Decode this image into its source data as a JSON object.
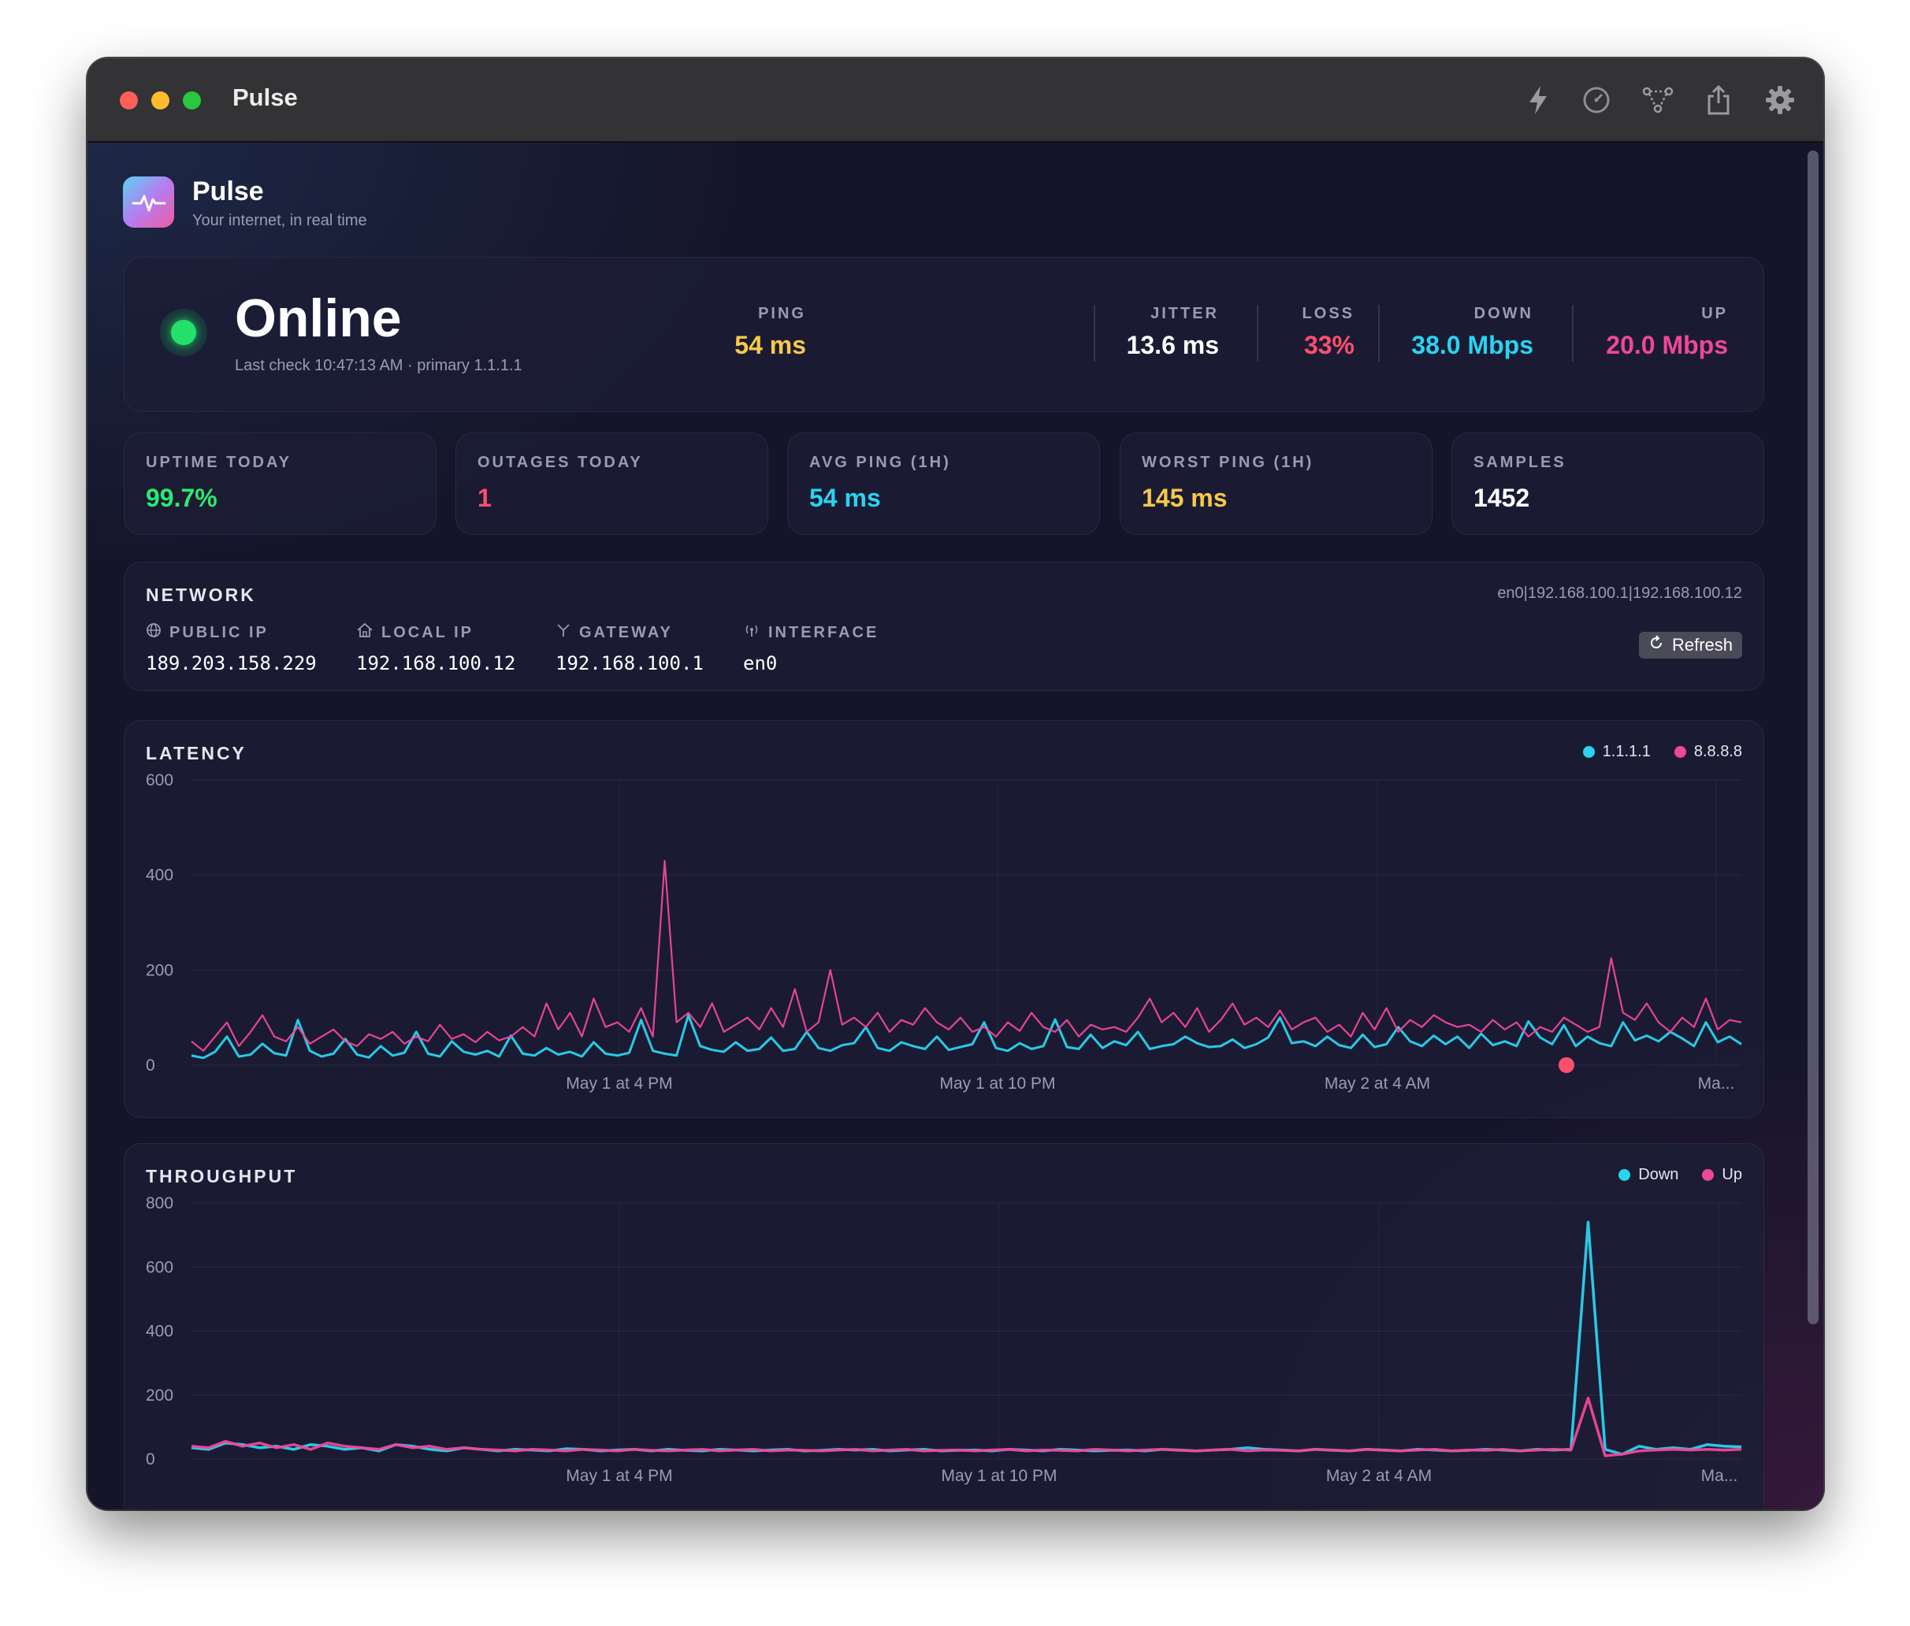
{
  "window": {
    "title": "Pulse"
  },
  "toolbar_icons": [
    "bolt-icon",
    "speedometer-icon",
    "network-icon",
    "share-icon",
    "gear-icon"
  ],
  "app": {
    "name": "Pulse",
    "subtitle": "Your internet, in real time"
  },
  "status": {
    "state": "Online",
    "detail": "Last check 10:47:13 AM · primary 1.1.1.1",
    "metrics": [
      {
        "label": "PING",
        "value": "54 ms",
        "color": "#f7c948"
      },
      {
        "label": "JITTER",
        "value": "13.6 ms",
        "color": "#ffffff"
      },
      {
        "label": "LOSS",
        "value": "33%",
        "color": "#ff4f6d"
      },
      {
        "label": "DOWN",
        "value": "38.0 Mbps",
        "color": "#2ad3f0"
      },
      {
        "label": "UP",
        "value": "20.0 Mbps",
        "color": "#f0479a"
      }
    ]
  },
  "stats": [
    {
      "label": "UPTIME TODAY",
      "value": "99.7%",
      "color": "#2ee86f"
    },
    {
      "label": "OUTAGES TODAY",
      "value": "1",
      "color": "#ff4f6d"
    },
    {
      "label": "AVG PING (1H)",
      "value": "54 ms",
      "color": "#2ad3f0"
    },
    {
      "label": "WORST PING (1H)",
      "value": "145 ms",
      "color": "#f7c948"
    },
    {
      "label": "SAMPLES",
      "value": "1452",
      "color": "#ffffff"
    }
  ],
  "network": {
    "title": "NETWORK",
    "summary": "en0|192.168.100.1|192.168.100.12",
    "public_ip_label": "PUBLIC IP",
    "public_ip": "189.203.158.229",
    "local_ip_label": "LOCAL IP",
    "local_ip": "192.168.100.12",
    "gateway_label": "GATEWAY",
    "gateway": "192.168.100.1",
    "interface_label": "INTERFACE",
    "interface": "en0",
    "refresh_label": "Refresh"
  },
  "chart_data": [
    {
      "type": "line",
      "title": "LATENCY",
      "ylim": [
        0,
        600
      ],
      "yticks": [
        "600",
        "400",
        "200",
        "0"
      ],
      "xticks": [
        "May 1 at 4 PM",
        "May 1 at 10 PM",
        "May 2 at 4 AM",
        "Ma..."
      ],
      "series": [
        {
          "name": "1.1.1.1",
          "color": "#2ad3f0",
          "values": [
            20,
            15,
            28,
            60,
            18,
            22,
            45,
            25,
            20,
            95,
            30,
            18,
            24,
            55,
            22,
            16,
            40,
            20,
            26,
            70,
            24,
            18,
            50,
            28,
            22,
            30,
            18,
            62,
            24,
            20,
            36,
            22,
            28,
            18,
            48,
            24,
            20,
            26,
            95,
            30,
            24,
            20,
            105,
            40,
            32,
            28,
            48,
            30,
            34,
            58,
            30,
            34,
            70,
            36,
            30,
            42,
            46,
            80,
            36,
            30,
            48,
            40,
            34,
            60,
            32,
            38,
            44,
            90,
            36,
            30,
            46,
            34,
            40,
            96,
            38,
            34,
            64,
            36,
            50,
            42,
            70,
            34,
            40,
            44,
            60,
            46,
            38,
            40,
            54,
            36,
            44,
            58,
            100,
            46,
            50,
            40,
            60,
            42,
            36,
            64,
            38,
            44,
            80,
            50,
            40,
            62,
            44,
            60,
            36,
            66,
            42,
            50,
            40,
            92,
            58,
            44,
            84,
            40,
            60,
            46,
            40,
            90,
            52,
            62,
            50,
            70,
            56,
            40,
            90,
            48,
            60,
            44
          ]
        },
        {
          "name": "8.8.8.8",
          "color": "#f0479a",
          "values": [
            50,
            30,
            60,
            90,
            40,
            70,
            105,
            60,
            50,
            80,
            45,
            60,
            75,
            50,
            40,
            65,
            55,
            70,
            45,
            60,
            50,
            85,
            55,
            65,
            48,
            70,
            52,
            60,
            80,
            60,
            130,
            75,
            110,
            60,
            140,
            80,
            90,
            70,
            120,
            60,
            430,
            90,
            110,
            80,
            130,
            70,
            85,
            100,
            75,
            120,
            80,
            160,
            70,
            90,
            200,
            85,
            100,
            80,
            110,
            70,
            95,
            85,
            120,
            90,
            75,
            100,
            70,
            80,
            60,
            90,
            72,
            110,
            80,
            70,
            95,
            60,
            85,
            75,
            80,
            70,
            100,
            140,
            90,
            110,
            80,
            120,
            70,
            95,
            130,
            85,
            100,
            80,
            115,
            75,
            90,
            100,
            70,
            85,
            60,
            110,
            75,
            120,
            70,
            95,
            80,
            105,
            90,
            80,
            85,
            70,
            95,
            75,
            90,
            60,
            80,
            70,
            100,
            85,
            70,
            80,
            225,
            110,
            95,
            130,
            90,
            70,
            100,
            80,
            140,
            75,
            95,
            90
          ]
        }
      ]
    },
    {
      "type": "line",
      "title": "THROUGHPUT",
      "ylim": [
        0,
        800
      ],
      "yticks": [
        "800",
        "600",
        "400",
        "200",
        "0"
      ],
      "xticks": [
        "May 1 at 4 PM",
        "May 1 at 10 PM",
        "May 2 at 4 AM",
        "Ma..."
      ],
      "series": [
        {
          "name": "Down",
          "color": "#2ad3f0",
          "values": [
            35,
            30,
            50,
            45,
            35,
            40,
            30,
            45,
            40,
            30,
            35,
            25,
            45,
            40,
            30,
            25,
            35,
            30,
            25,
            30,
            28,
            25,
            32,
            30,
            25,
            28,
            30,
            25,
            30,
            27,
            25,
            30,
            28,
            25,
            28,
            30,
            25,
            27,
            30,
            28,
            30,
            25,
            28,
            30,
            25,
            27,
            28,
            25,
            30,
            28,
            25,
            30,
            28,
            25,
            27,
            28,
            25,
            30,
            28,
            25,
            28,
            30,
            35,
            30,
            28,
            25,
            30,
            27,
            25,
            30,
            28,
            25,
            30,
            28,
            25,
            27,
            30,
            28,
            25,
            30,
            28,
            30,
            740,
            30,
            15,
            40,
            30,
            35,
            30,
            45,
            40,
            38
          ]
        },
        {
          "name": "Up",
          "color": "#f0479a",
          "values": [
            40,
            35,
            55,
            40,
            50,
            35,
            45,
            30,
            50,
            40,
            35,
            30,
            45,
            35,
            40,
            30,
            35,
            30,
            28,
            25,
            30,
            28,
            25,
            30,
            28,
            25,
            30,
            27,
            25,
            28,
            30,
            25,
            28,
            30,
            25,
            28,
            27,
            25,
            28,
            30,
            25,
            28,
            30,
            25,
            27,
            28,
            25,
            28,
            30,
            25,
            28,
            27,
            25,
            30,
            28,
            25,
            28,
            30,
            27,
            25,
            28,
            30,
            25,
            28,
            27,
            25,
            30,
            28,
            25,
            30,
            27,
            25,
            28,
            30,
            25,
            28,
            27,
            30,
            25,
            28,
            30,
            28,
            190,
            10,
            15,
            25,
            28,
            30,
            28,
            30,
            28,
            30
          ]
        }
      ]
    }
  ],
  "outage_marker_color": "#ff4f6d"
}
